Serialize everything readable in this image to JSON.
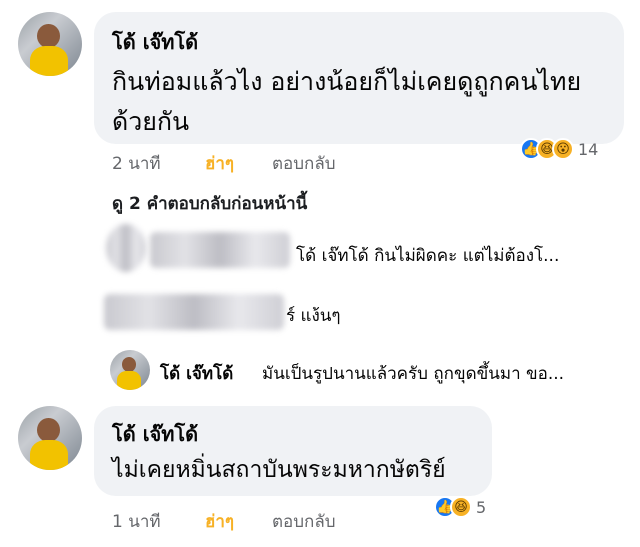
{
  "comments": [
    {
      "author": "โด้ เจ๊ทโด้",
      "text_line1": "กินท่อมแล้วไง อย่างน้อยก็ไม่เคยดูถูกคนไทย",
      "text_line2": "ด้วยกัน",
      "time": "2 นาที",
      "reaction_label": "ฮ่าๆ",
      "reply_label": "ตอบกลับ",
      "reaction_icons": [
        "like-icon",
        "haha-icon",
        "wow-icon"
      ],
      "reaction_count": "14"
    },
    {
      "author": "โด้ เจ๊ทโด้",
      "text": "ไม่เคยหมิ่นสถาบันพระมหากษัตริย์",
      "time": "1 นาที",
      "reaction_label": "ฮ่าๆ",
      "reply_label": "ตอบกลับ",
      "reaction_icons": [
        "like-icon",
        "haha-icon"
      ],
      "reaction_count": "5"
    }
  ],
  "view_previous_replies": "ดู 2 คำตอบกลับก่อนหน้านี้",
  "replies": [
    {
      "text": "โด้ เจ๊ทโด้ กินไม่ผิดคะ แต่ไม่ต้องโ..."
    },
    {
      "text": "ร์ แง้นๆ"
    },
    {
      "author": "โด้ เจ๊ทโด้",
      "text": "มันเป็นรูปนานแล้วครับ ถูกขุดขึ้นมา ขอ..."
    }
  ],
  "colors": {
    "bubble": "#f0f2f5",
    "meta_text": "#65676b",
    "like_blue": "#1877f2",
    "haha_yellow": "#f7b125"
  }
}
